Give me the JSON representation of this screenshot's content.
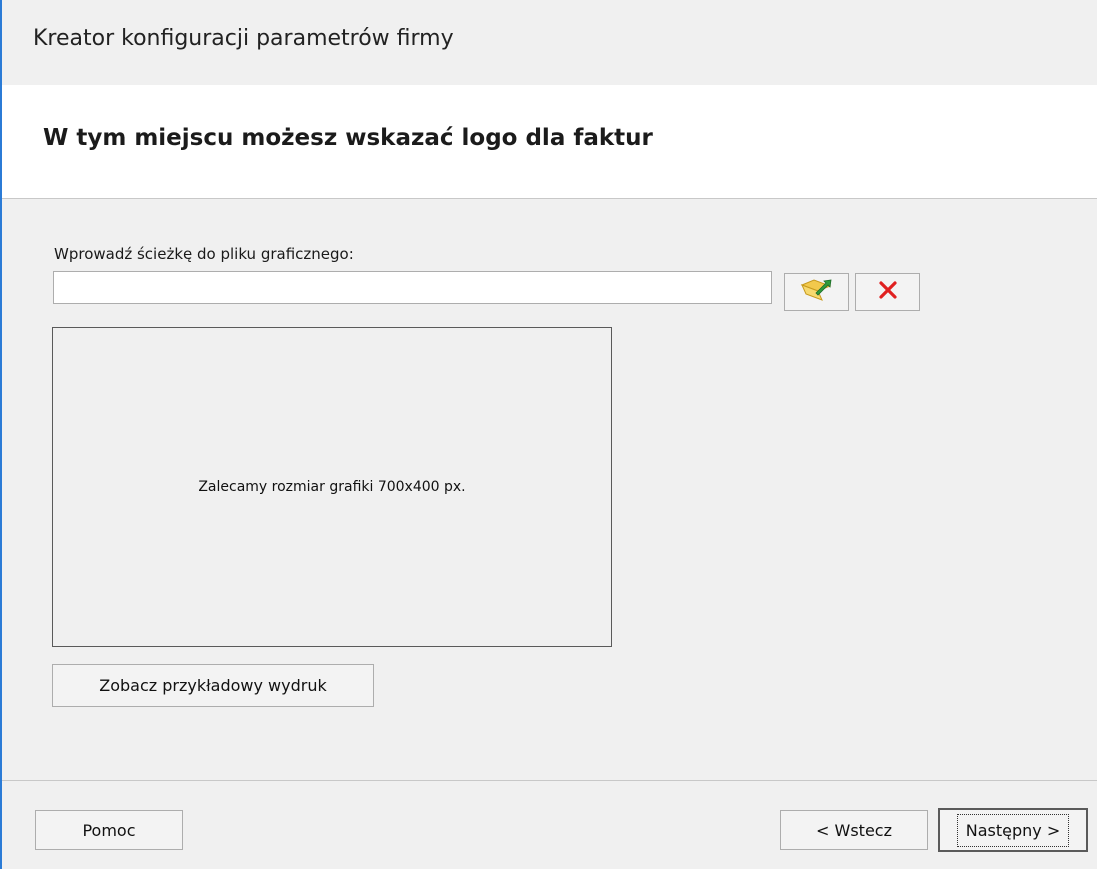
{
  "window": {
    "title": "Kreator konfiguracji parametrów firmy"
  },
  "header": {
    "heading": "W tym miejscu możesz wskazać logo dla faktur"
  },
  "form": {
    "path_label": "Wprowadź ścieżkę do pliku graficznego:",
    "path_value": "",
    "browse_icon": "folder-open-icon",
    "clear_icon": "close-icon",
    "preview_hint": "Zalecamy rozmiar grafiki 700x400 px.",
    "sample_button": "Zobacz przykładowy wydruk"
  },
  "footer": {
    "help": "Pomoc",
    "back": "< Wstecz",
    "next": "Następny >"
  },
  "colors": {
    "accent_border": "#2b7bd6",
    "clear_red": "#e02020",
    "folder_yellow": "#f2c94c",
    "arrow_green": "#2e9b3c"
  }
}
